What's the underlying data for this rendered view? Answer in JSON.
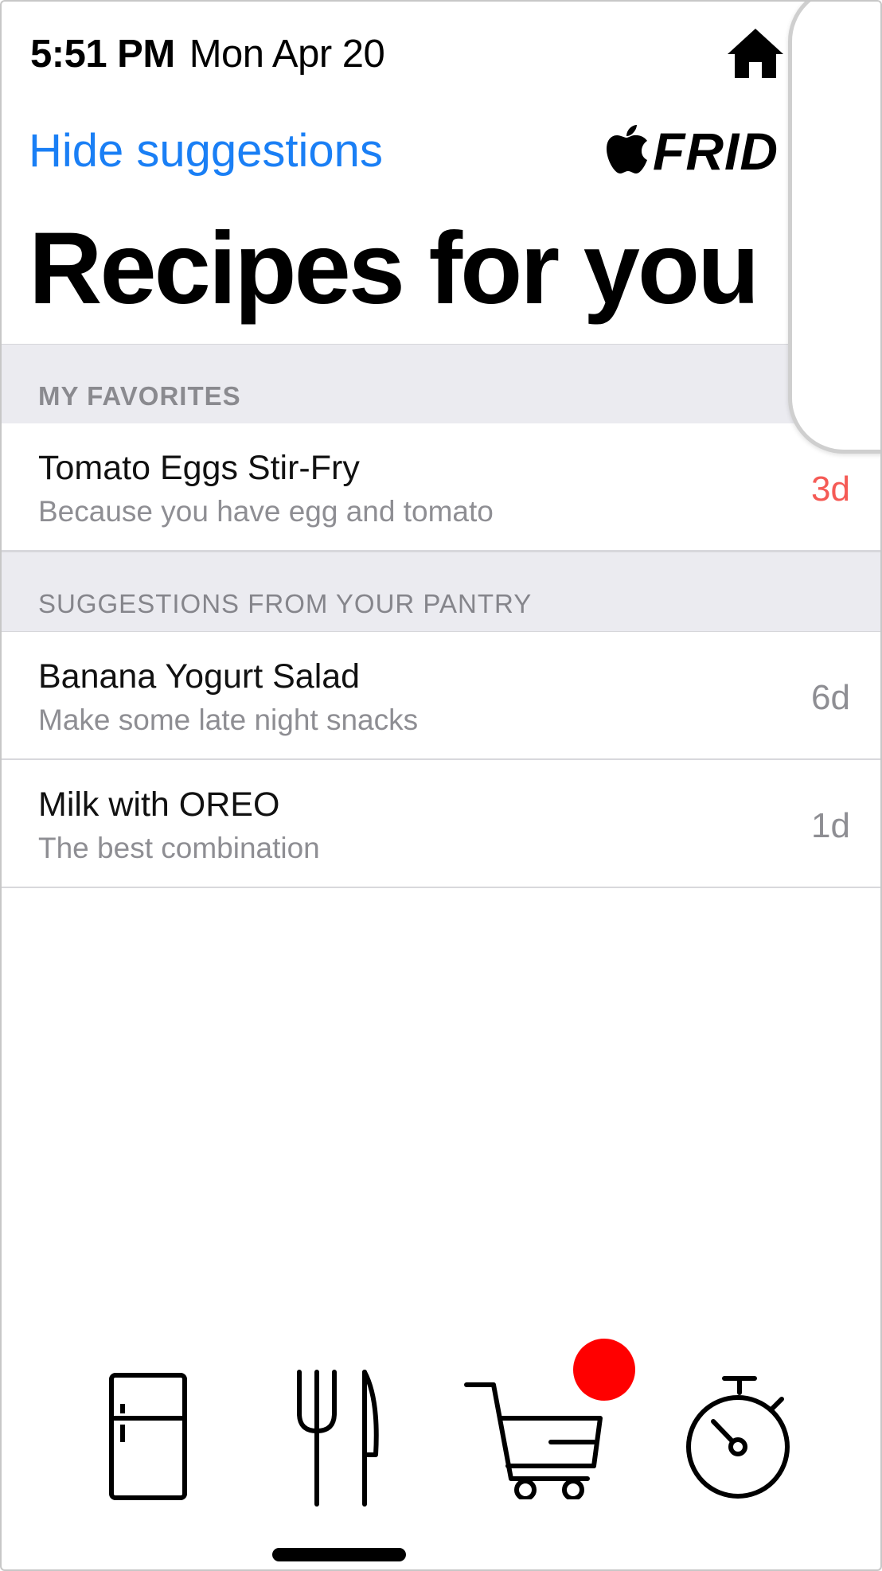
{
  "status_bar": {
    "time": "5:51 PM",
    "date": "Mon Apr 20"
  },
  "header": {
    "hide_suggestions_label": "Hide suggestions",
    "brand_name": "FRID",
    "title": "Recipes for you"
  },
  "sections": [
    {
      "title": "MY FAVORITES"
    },
    {
      "title": "SUGGESTIONS FROM YOUR PANTRY"
    }
  ],
  "recipes": [
    {
      "title": "Tomato Eggs Stir-Fry",
      "subtitle": "Because you have egg and tomato",
      "days": "3d",
      "days_color": "#f55a55"
    },
    {
      "title": "Banana Yogurt Salad",
      "subtitle": "Make some late night snacks",
      "days": "6d",
      "days_color": "#8e8e93"
    },
    {
      "title": "Milk with OREO",
      "subtitle": "The best combination",
      "days": "1d",
      "days_color": "#8e8e93"
    }
  ],
  "tab_bar": {
    "tabs": [
      {
        "icon": "fridge-icon"
      },
      {
        "icon": "fork-knife-icon"
      },
      {
        "icon": "shopping-cart-icon"
      },
      {
        "icon": "stopwatch-icon"
      }
    ],
    "badge_color": "#ff0000"
  },
  "accent_color": "#1a7ff5"
}
